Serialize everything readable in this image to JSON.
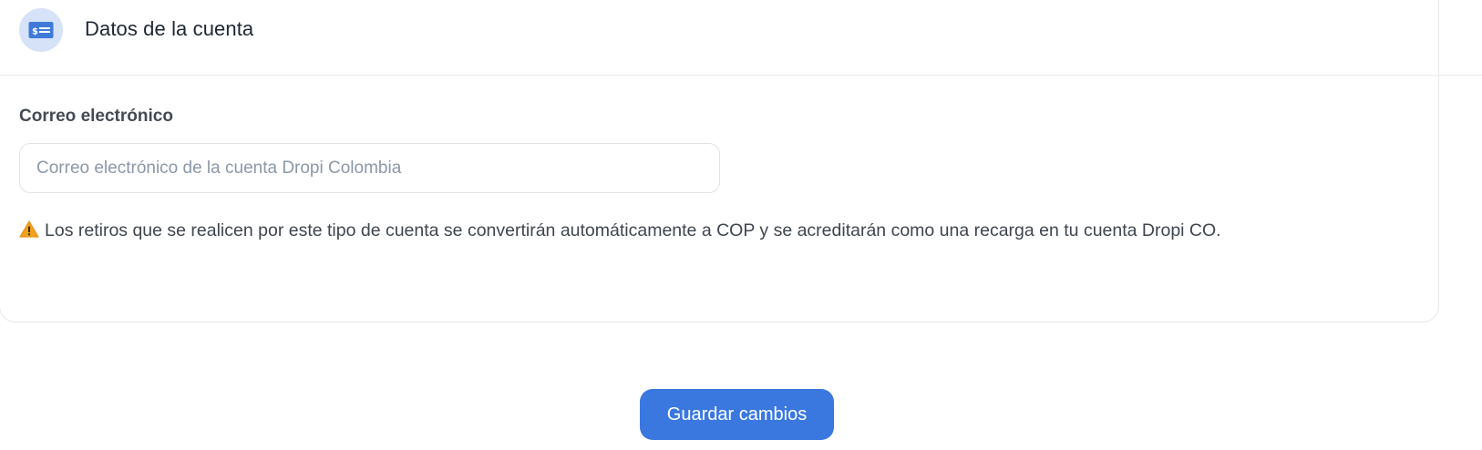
{
  "section": {
    "title": "Datos de la cuenta",
    "icon": "money-card-icon"
  },
  "email_field": {
    "label": "Correo electrónico",
    "placeholder": "Correo electrónico de la cuenta Dropi Colombia",
    "value": ""
  },
  "notice": {
    "icon": "warning-icon",
    "text": "Los retiros que se realicen por este tipo de cuenta se convertirán automáticamente a COP y se acreditarán como una recarga en tu cuenta Dropi CO."
  },
  "actions": {
    "save_label": "Guardar cambios"
  },
  "colors": {
    "primary": "#3a78e0",
    "icon_bg": "#d5e2f8",
    "warning": "#f0a21a"
  }
}
